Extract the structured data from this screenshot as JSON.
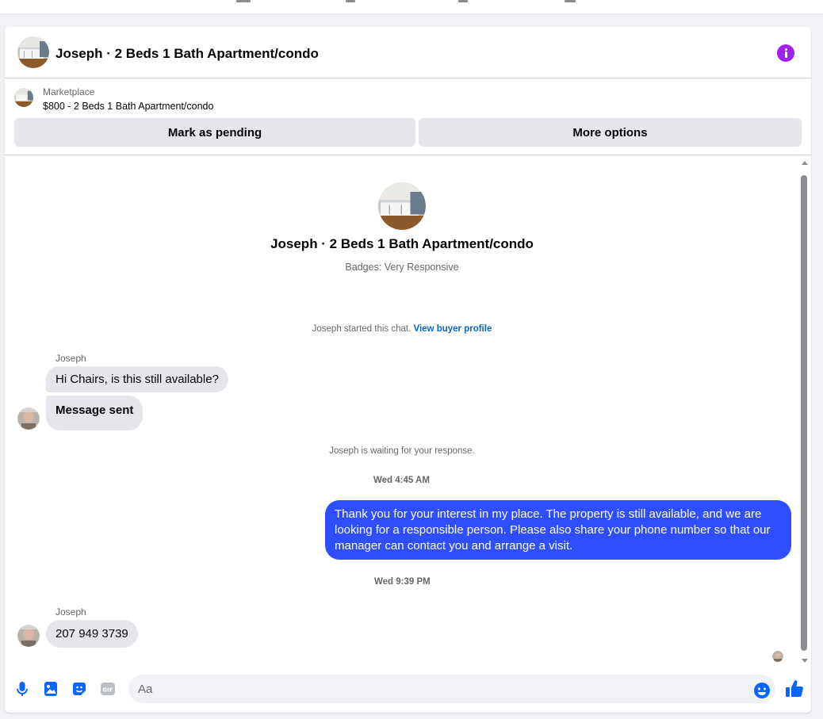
{
  "header": {
    "title": "Joseph · 2 Beds 1 Bath Apartment/condo",
    "info_icon": "info-circle-icon"
  },
  "listing": {
    "label": "Marketplace",
    "price_title": "$800 - 2 Beds 1 Bath Apartment/condo",
    "mark_pending_label": "Mark as pending",
    "more_options_label": "More options"
  },
  "profile": {
    "title": "Joseph · 2 Beds 1 Bath Apartment/condo",
    "badges": "Badges: Very Responsive"
  },
  "chat": {
    "started_text": "Joseph started this chat.",
    "started_link": "View buyer profile",
    "waiting_text": "Joseph is waiting for your response.",
    "sender_name": "Joseph",
    "messages": [
      {
        "from": "Joseph",
        "text": "Hi Chairs, is this still available?"
      },
      {
        "from": "Joseph",
        "text": "Message sent"
      },
      {
        "from": "me",
        "text": "Thank you for your interest in my place. The property is still available, and we are looking for a responsible person. Please also share your phone number so that our manager can contact you and arrange a visit."
      },
      {
        "from": "Joseph",
        "text": "207 949 3739"
      }
    ],
    "timestamps": [
      "Wed 4:45 AM",
      "Wed 9:39 PM"
    ]
  },
  "composer": {
    "placeholder": "Aa",
    "icons": [
      "microphone-icon",
      "image-icon",
      "sticker-icon",
      "gif-icon",
      "emoji-icon",
      "thumbs-up-icon"
    ]
  },
  "colors": {
    "accent_blue": "#0866ff",
    "outgoing_bubble": "#2e4fff",
    "info_purple": "#a020f0",
    "incoming_bubble": "#e4e6eb"
  }
}
